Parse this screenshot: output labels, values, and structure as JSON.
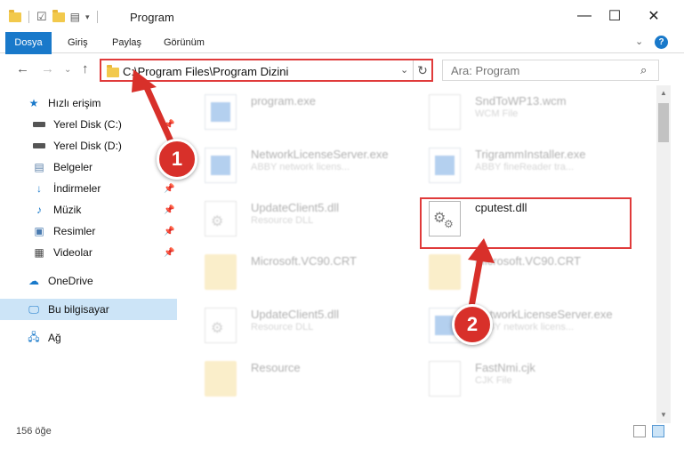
{
  "window": {
    "title": "Program"
  },
  "ribbon": {
    "tabs": [
      "Dosya",
      "Giriş",
      "Paylaş",
      "Görünüm"
    ]
  },
  "address": {
    "path": "C:\\Program Files\\Program Dizini"
  },
  "search": {
    "placeholder": "Ara: Program"
  },
  "sidebar": {
    "items": [
      {
        "label": "Hızlı erişim",
        "icon": "star-icon"
      },
      {
        "label": "Yerel Disk (C:)",
        "icon": "drive-icon"
      },
      {
        "label": "Yerel Disk (D:)",
        "icon": "drive-icon"
      },
      {
        "label": "Belgeler",
        "icon": "documents-icon"
      },
      {
        "label": "İndirmeler",
        "icon": "download-icon"
      },
      {
        "label": "Müzik",
        "icon": "music-icon"
      },
      {
        "label": "Resimler",
        "icon": "pictures-icon"
      },
      {
        "label": "Videolar",
        "icon": "video-icon"
      },
      {
        "label": "OneDrive",
        "icon": "cloud-icon"
      },
      {
        "label": "Bu bilgisayar",
        "icon": "computer-icon"
      },
      {
        "label": "Ağ",
        "icon": "network-icon"
      }
    ]
  },
  "files": [
    {
      "name": "program.exe",
      "desc": ""
    },
    {
      "name": "SndToWP13.wcm",
      "desc": "WCM File"
    },
    {
      "name": "NetworkLicenseServer.exe",
      "desc": "ABBY network licens..."
    },
    {
      "name": "TrigrammInstaller.exe",
      "desc": "ABBY fineReader tra..."
    },
    {
      "name": "UpdateClient5.dll",
      "desc": "Resource DLL"
    },
    {
      "name": "cputest.dll",
      "desc": ""
    },
    {
      "name": "Microsoft.VC90.CRT",
      "desc": ""
    },
    {
      "name": "Microsoft.VC90.CRT",
      "desc": ""
    },
    {
      "name": "UpdateClient5.dll",
      "desc": "Resource DLL"
    },
    {
      "name": "NetworkLicenseServer.exe",
      "desc": "ABBY network licens..."
    },
    {
      "name": "Resource",
      "desc": ""
    },
    {
      "name": "FastNmi.cjk",
      "desc": "CJK File"
    }
  ],
  "status": {
    "count": "156 öğe"
  },
  "annotations": {
    "step1": "1",
    "step2": "2"
  },
  "colors": {
    "accent": "#1979ca",
    "highlight": "#e03a3a",
    "badge": "#d8302a"
  }
}
